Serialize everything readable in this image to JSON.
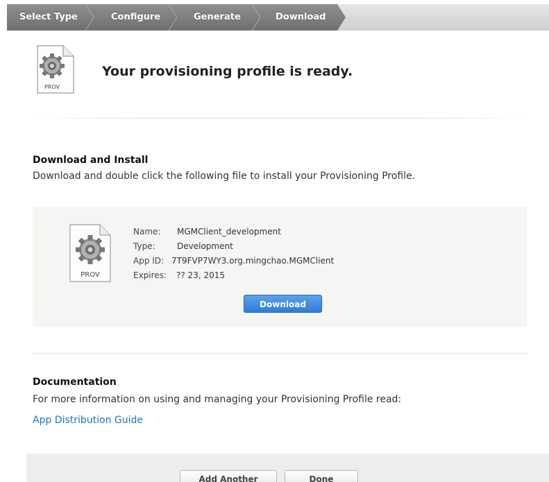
{
  "steps": [
    {
      "label": "Select Type"
    },
    {
      "label": "Configure"
    },
    {
      "label": "Generate"
    },
    {
      "label": "Download"
    }
  ],
  "header": {
    "icon_label": "PROV",
    "title": "Your provisioning profile is ready."
  },
  "download_section": {
    "heading": "Download and Install",
    "description": "Download and double click the following file to install your Provisioning Profile.",
    "profile": {
      "icon_label": "PROV",
      "name_label": "Name:",
      "name_value": "MGMClient_development",
      "type_label": "Type:",
      "type_value": "Development",
      "appid_label": "App ID:",
      "appid_value": "7T9FVP7WY3.org.mingchao.MGMClient",
      "expires_label": "Expires:",
      "expires_value": "?? 23, 2015"
    },
    "download_button": "Download"
  },
  "documentation": {
    "heading": "Documentation",
    "text": "For more information on using and managing your Provisioning Profile read:",
    "link": "App Distribution Guide"
  },
  "footer": {
    "add_another": "Add Another",
    "done": "Done"
  },
  "colors": {
    "accent_blue": "#2f7dd8",
    "link_blue": "#1b76c2",
    "step_active": "#7a7a7a"
  }
}
